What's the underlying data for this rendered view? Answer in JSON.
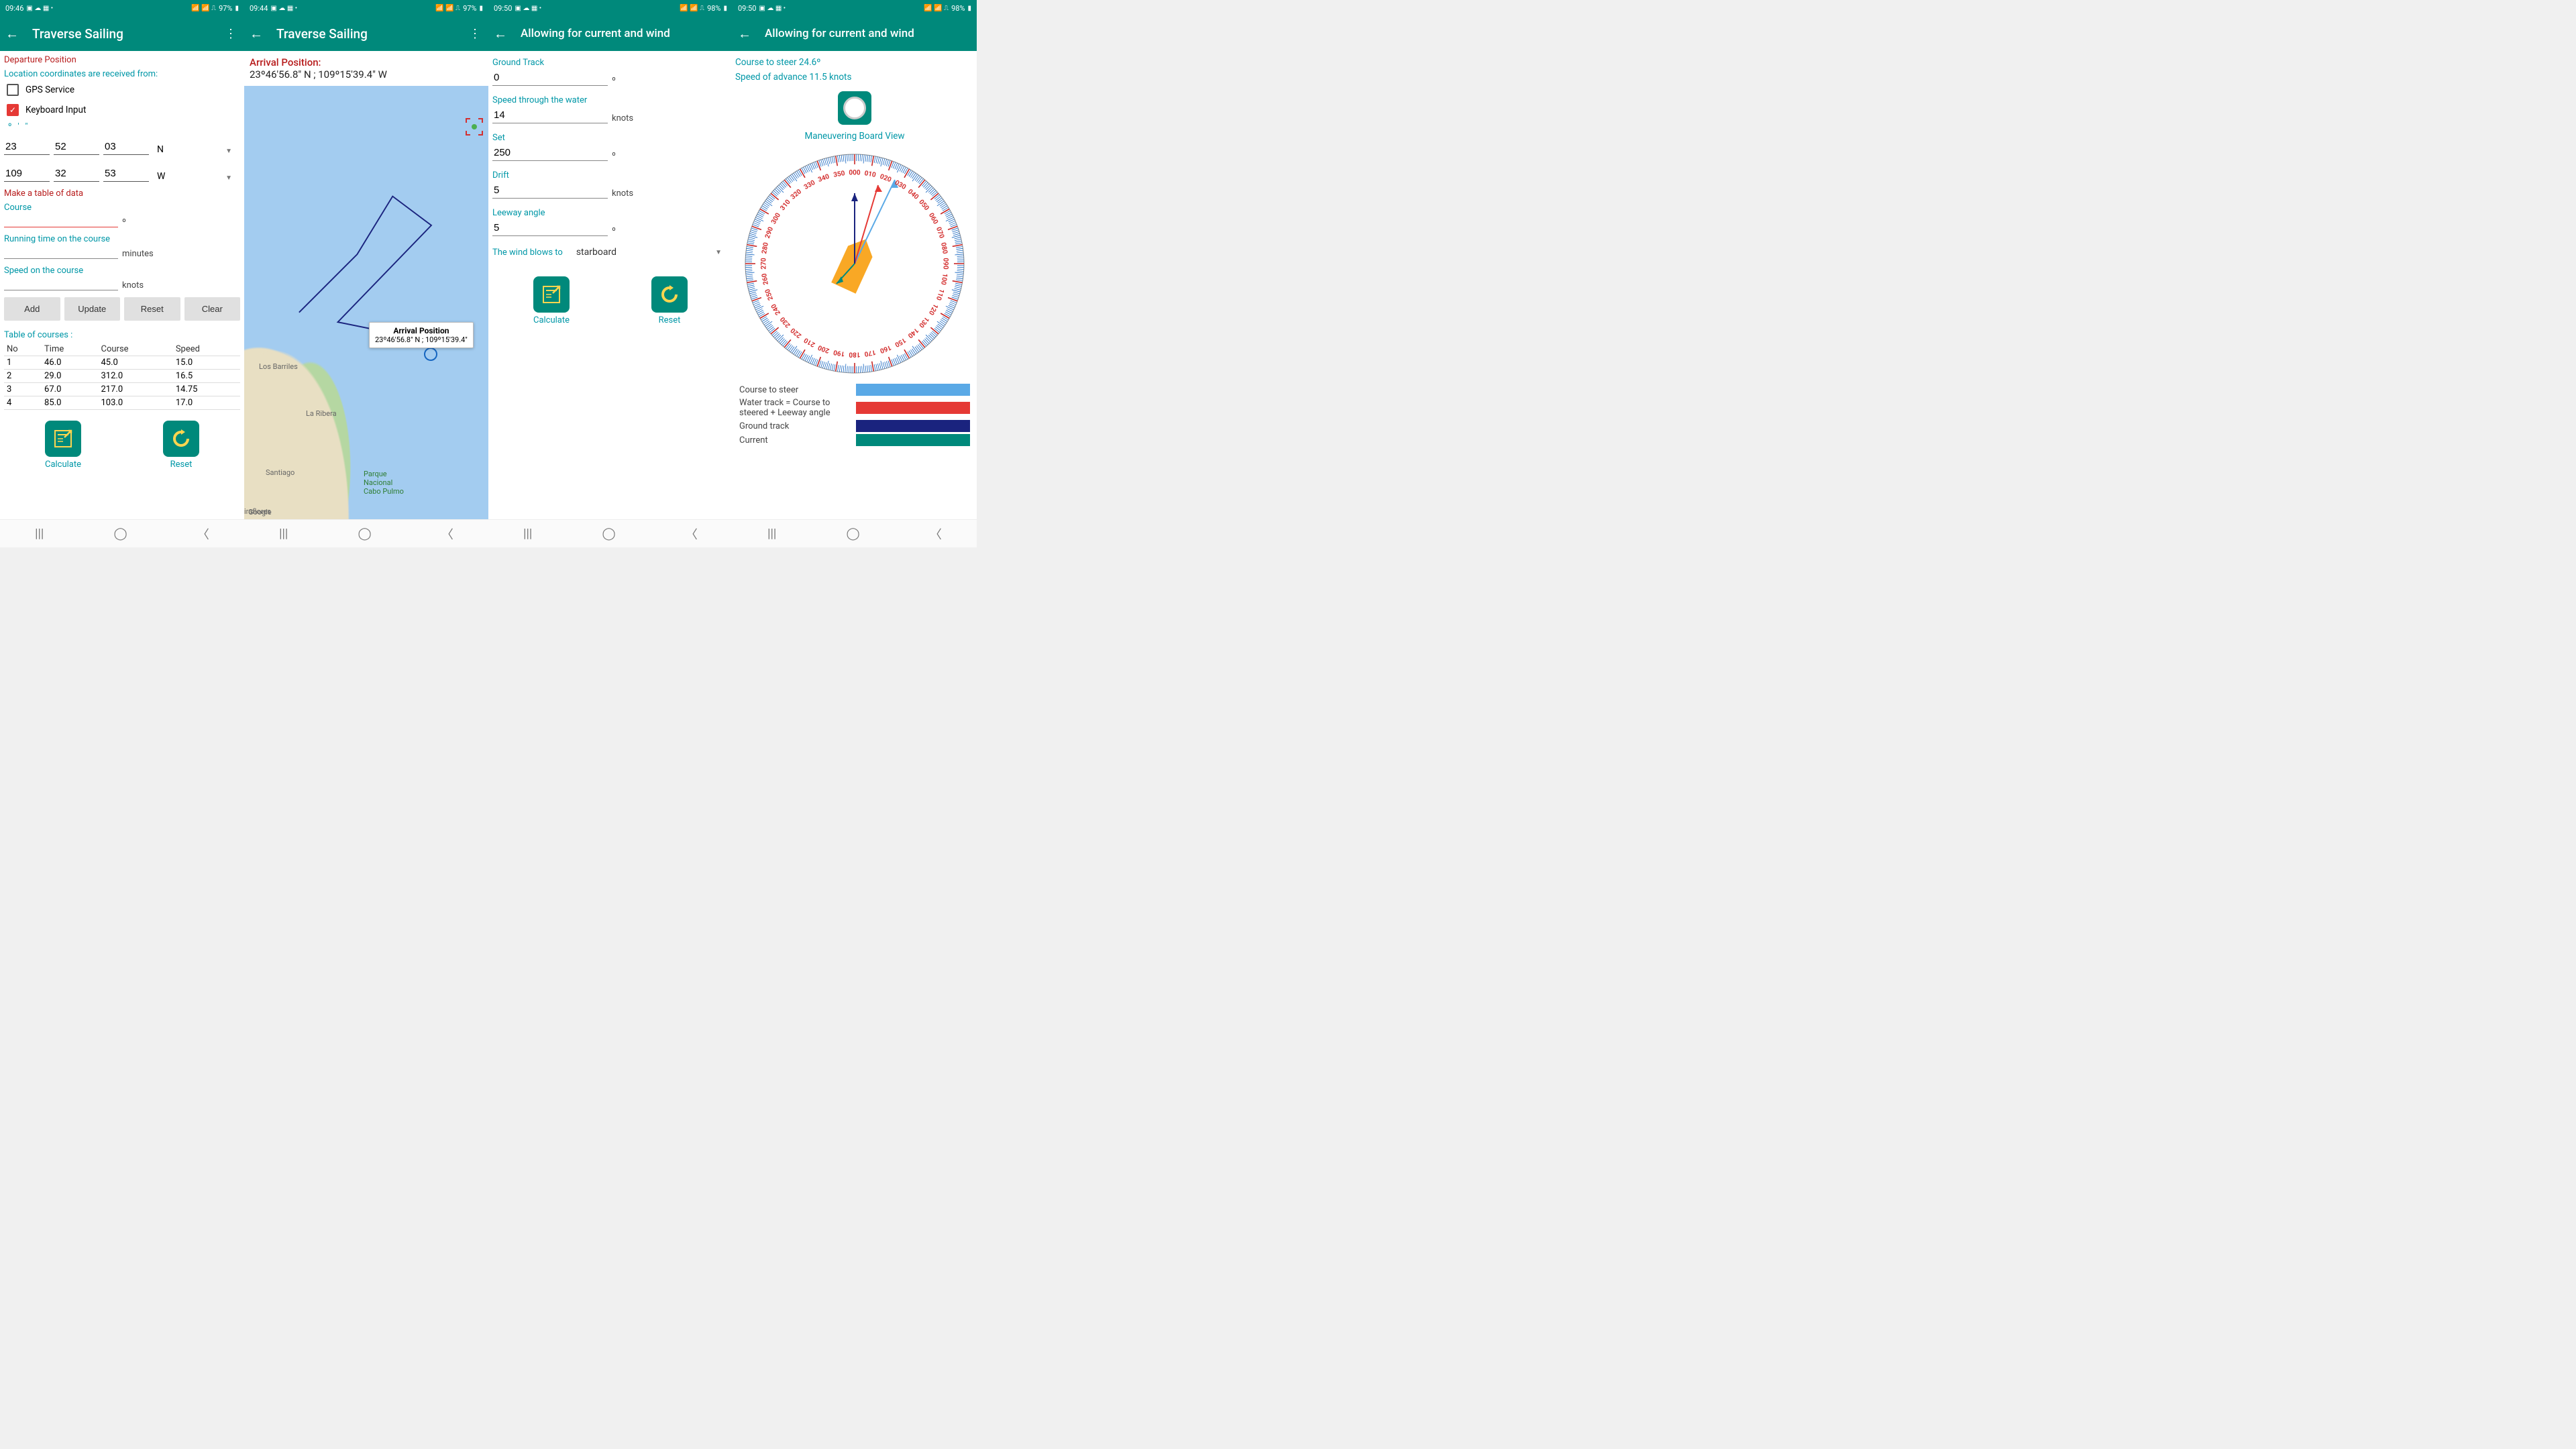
{
  "screens": [
    {
      "status": {
        "time": "09:46",
        "battery": "97%"
      },
      "title": "Traverse Sailing",
      "departure": "Departure Position",
      "received_from": "Location coordinates are received from:",
      "gps": "GPS Service",
      "kbd": "Keyboard Input",
      "dms": "º ' \"",
      "lat": {
        "d": "23",
        "m": "52",
        "s": "03",
        "dir": "N"
      },
      "lon": {
        "d": "109",
        "m": "32",
        "s": "53",
        "dir": "W"
      },
      "make_table": "Make a table of data",
      "course_label": "Course",
      "runtime_label": "Running time on the course",
      "runtime_unit": "minutes",
      "speed_label": "Speed on the course",
      "speed_unit": "knots",
      "buttons": {
        "add": "Add",
        "update": "Update",
        "reset": "Reset",
        "clear": "Clear"
      },
      "table_title": "Table of courses :",
      "table_headers": {
        "no": "No",
        "time": "Time",
        "course": "Course",
        "speed": "Speed"
      },
      "courses": [
        {
          "no": "1",
          "time": "46.0",
          "course": "45.0",
          "speed": "15.0"
        },
        {
          "no": "2",
          "time": "29.0",
          "course": "312.0",
          "speed": "16.5"
        },
        {
          "no": "3",
          "time": "67.0",
          "course": "217.0",
          "speed": "14.75"
        },
        {
          "no": "4",
          "time": "85.0",
          "course": "103.0",
          "speed": "17.0"
        }
      ],
      "calc": "Calculate",
      "resetbtn": "Reset"
    },
    {
      "status": {
        "time": "09:44",
        "battery": "97%"
      },
      "title": "Traverse Sailing",
      "arrival_label": "Arrival Position:",
      "arrival_coords": "23º46'56.8\" N ; 109º15'39.4\" W",
      "callout_title": "Arrival Position",
      "callout_coords": "23º46'56.8\" N ; 109º15'39.4\"",
      "places": {
        "barriles": "Los Barriles",
        "ribera": "La Ribera",
        "santiago": "Santiago",
        "parque": "Parque\nNacional\nCabo Pulmo",
        "iraflores": "iraflores",
        "google": "Google"
      }
    },
    {
      "status": {
        "time": "09:50",
        "battery": "98%"
      },
      "title": "Allowing for current and wind",
      "gt_label": "Ground Track",
      "gt_val": "0",
      "deg": "º",
      "stw_label": "Speed through the water",
      "stw_val": "14",
      "knots": "knots",
      "set_label": "Set",
      "set_val": "250",
      "drift_label": "Drift",
      "drift_val": "5",
      "leeway_label": "Leeway angle",
      "leeway_val": "5",
      "wind_label": "The wind blows to",
      "wind_val": "starboard",
      "calc": "Calculate",
      "reset": "Reset"
    },
    {
      "status": {
        "time": "09:50",
        "battery": "98%"
      },
      "title": "Allowing for current and wind",
      "course_steer": "Course to steer 24.6º",
      "soa": "Speed of advance 11.5 knots",
      "mboard": "Maneuvering Board View",
      "legend": {
        "course": "Course to steer",
        "water": "Water track = Course to steered + Leeway angle",
        "ground": "Ground track",
        "current": "Current"
      }
    }
  ]
}
